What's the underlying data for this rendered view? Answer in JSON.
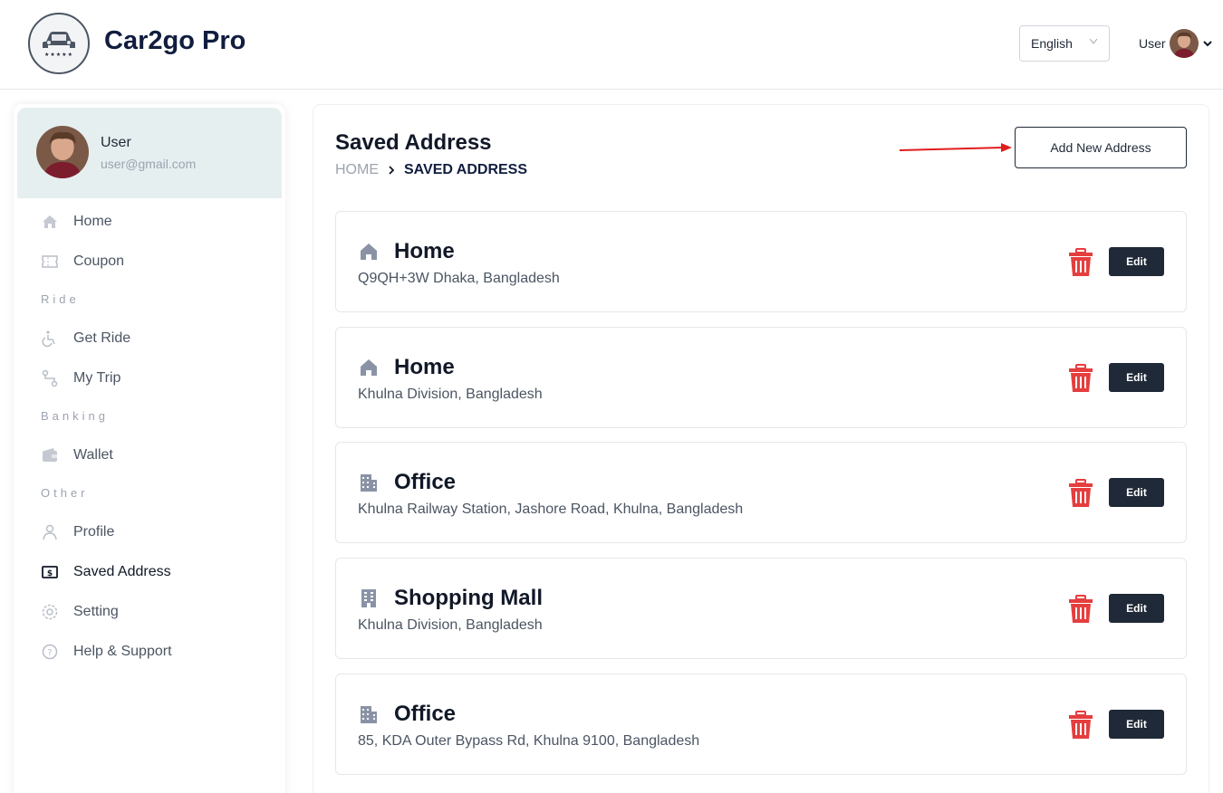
{
  "header": {
    "brand": "Car2go Pro",
    "logo_stars": "★★★★★",
    "language": "English",
    "user_label": "User"
  },
  "profile": {
    "name": "User",
    "email": "user@gmail.com"
  },
  "nav": {
    "home": "Home",
    "coupon": "Coupon",
    "section_ride": "Ride",
    "get_ride": "Get Ride",
    "my_trip": "My Trip",
    "section_banking": "Banking",
    "wallet": "Wallet",
    "section_other": "Other",
    "profile": "Profile",
    "saved_address": "Saved Address",
    "setting": "Setting",
    "help": "Help & Support"
  },
  "page": {
    "title": "Saved Address",
    "breadcrumb_home": "HOME",
    "breadcrumb_separator": ">",
    "breadcrumb_current": "SAVED ADDRESS",
    "add_button": "Add New Address"
  },
  "addresses": [
    {
      "type": "Home",
      "icon": "house-icon",
      "address": "Q9QH+3W Dhaka, Bangladesh",
      "edit_label": "Edit"
    },
    {
      "type": "Home",
      "icon": "house-icon",
      "address": "Khulna Division, Bangladesh",
      "edit_label": "Edit"
    },
    {
      "type": "Office",
      "icon": "office-building-icon",
      "address": "Khulna Railway Station, Jashore Road, Khulna, Bangladesh",
      "edit_label": "Edit"
    },
    {
      "type": "Shopping Mall",
      "icon": "mall-building-icon",
      "address": "Khulna Division, Bangladesh",
      "edit_label": "Edit"
    },
    {
      "type": "Office",
      "icon": "office-building-icon",
      "address": "85, KDA Outer Bypass Rd, Khulna 9100, Bangladesh",
      "edit_label": "Edit"
    }
  ],
  "colors": {
    "brand_navy": "#111d3f",
    "delete_red": "#e53e3e",
    "edit_dark": "#1f2937",
    "profile_bg": "#e6eff0",
    "annotation_arrow": "#e11d1d"
  }
}
